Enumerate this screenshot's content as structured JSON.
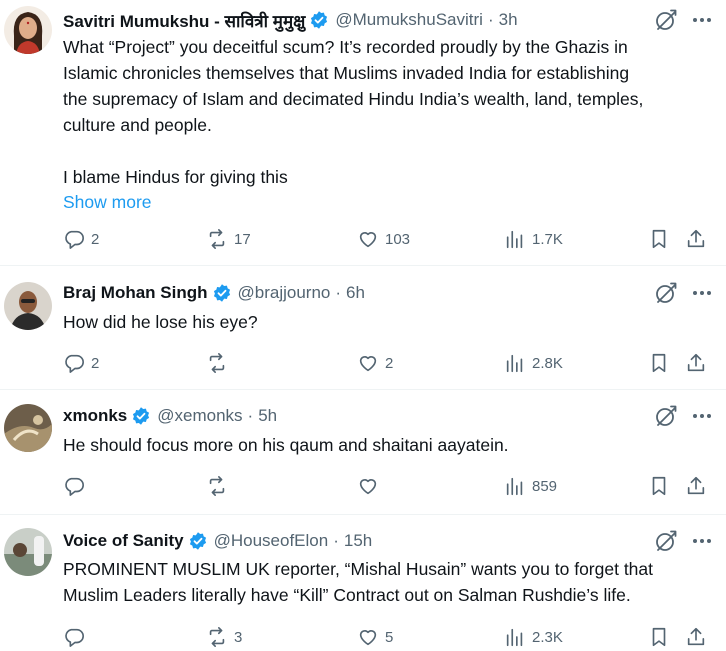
{
  "tweets": [
    {
      "name": "Savitri Mumukshu - सावित्री मुमुक्षु",
      "handle": "@MumukshuSavitri",
      "time": "3h",
      "lines": [
        "What “Project” you deceitful scum? It’s recorded proudly by the Ghazis in",
        "Islamic chronicles themselves that Muslims invaded India for establishing",
        "the supremacy of Islam and decimated Hindu India’s wealth, land, temples,",
        "culture and people."
      ],
      "lines2": [
        "I blame Hindus for giving this"
      ],
      "show_more": "Show more",
      "replies": "2",
      "reposts": "17",
      "likes": "103",
      "views": "1.7K"
    },
    {
      "name": "Braj Mohan Singh",
      "handle": "@brajjourno",
      "time": "6h",
      "lines": [
        "How did he lose his eye?"
      ],
      "replies": "2",
      "reposts": "",
      "likes": "2",
      "views": "2.8K"
    },
    {
      "name": "xmonks",
      "handle": "@xemonks",
      "time": "5h",
      "lines": [
        "He should focus more on his qaum and shaitani aayatein."
      ],
      "replies": "",
      "reposts": "",
      "likes": "",
      "views": "859"
    },
    {
      "name": "Voice of Sanity",
      "handle": "@HouseofElon",
      "time": "15h",
      "lines": [
        "PROMINENT MUSLIM UK reporter, “Mishal Husain” wants you to forget that",
        "Muslim Leaders literally have “Kill” Contract out on Salman Rushdie’s life."
      ],
      "replies": "",
      "reposts": "3",
      "likes": "5",
      "views": "2.3K"
    }
  ],
  "colors": {
    "text": "#0f1419",
    "muted": "#536471",
    "link": "#1d9bf0",
    "verified": "#1d9bf0",
    "divider": "#eff3f4"
  },
  "icons": [
    "verified-badge-icon",
    "grok-icon",
    "more-icon",
    "reply-icon",
    "repost-icon",
    "like-icon",
    "views-icon",
    "bookmark-icon",
    "share-icon"
  ]
}
